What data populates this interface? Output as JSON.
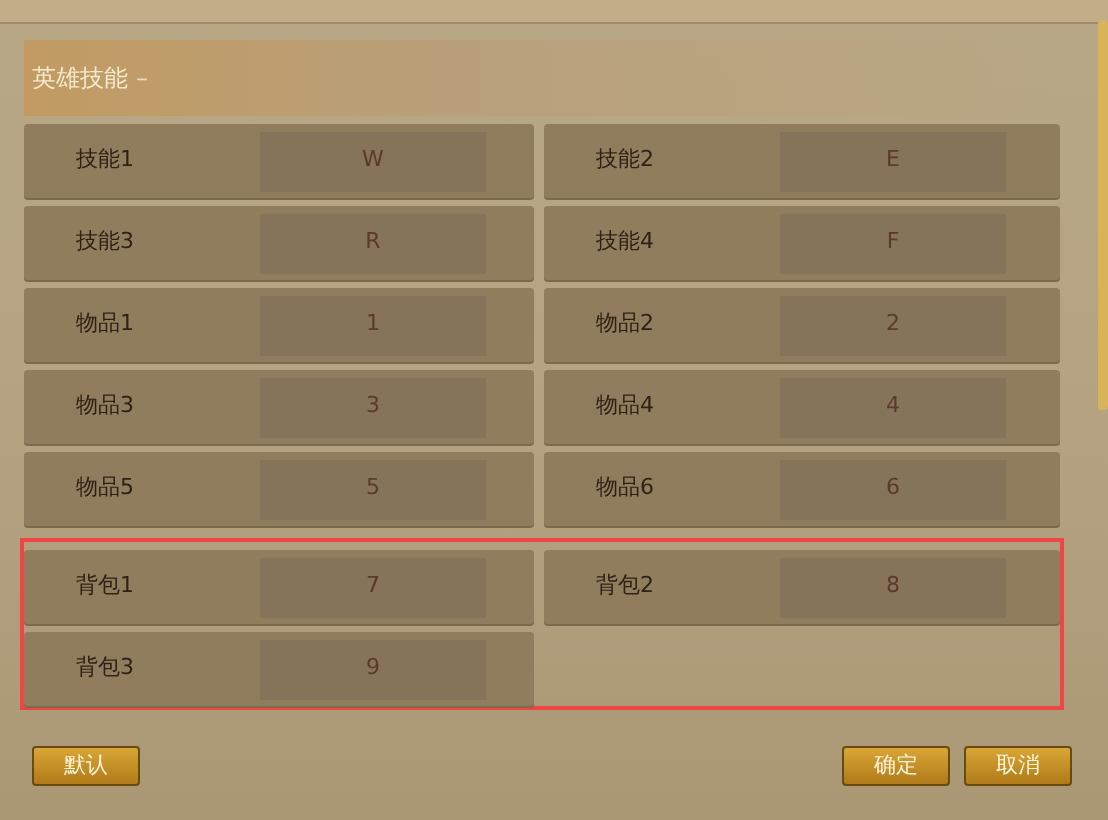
{
  "section": {
    "title": "英雄技能",
    "toggle": "–"
  },
  "bindings": [
    {
      "label": "技能1",
      "key": "W",
      "highlighted": false
    },
    {
      "label": "技能2",
      "key": "E",
      "highlighted": false
    },
    {
      "label": "技能3",
      "key": "R",
      "highlighted": false
    },
    {
      "label": "技能4",
      "key": "F",
      "highlighted": false
    },
    {
      "label": "物品1",
      "key": "1",
      "highlighted": false
    },
    {
      "label": "物品2",
      "key": "2",
      "highlighted": false
    },
    {
      "label": "物品3",
      "key": "3",
      "highlighted": false
    },
    {
      "label": "物品4",
      "key": "4",
      "highlighted": false
    },
    {
      "label": "物品5",
      "key": "5",
      "highlighted": false
    },
    {
      "label": "物品6",
      "key": "6",
      "highlighted": false
    },
    {
      "label": "背包1",
      "key": "7",
      "highlighted": true
    },
    {
      "label": "背包2",
      "key": "8",
      "highlighted": true
    },
    {
      "label": "背包3",
      "key": "9",
      "highlighted": true
    }
  ],
  "left_buttons": [
    "默认"
  ],
  "right_buttons": [
    "确定",
    "取消"
  ]
}
